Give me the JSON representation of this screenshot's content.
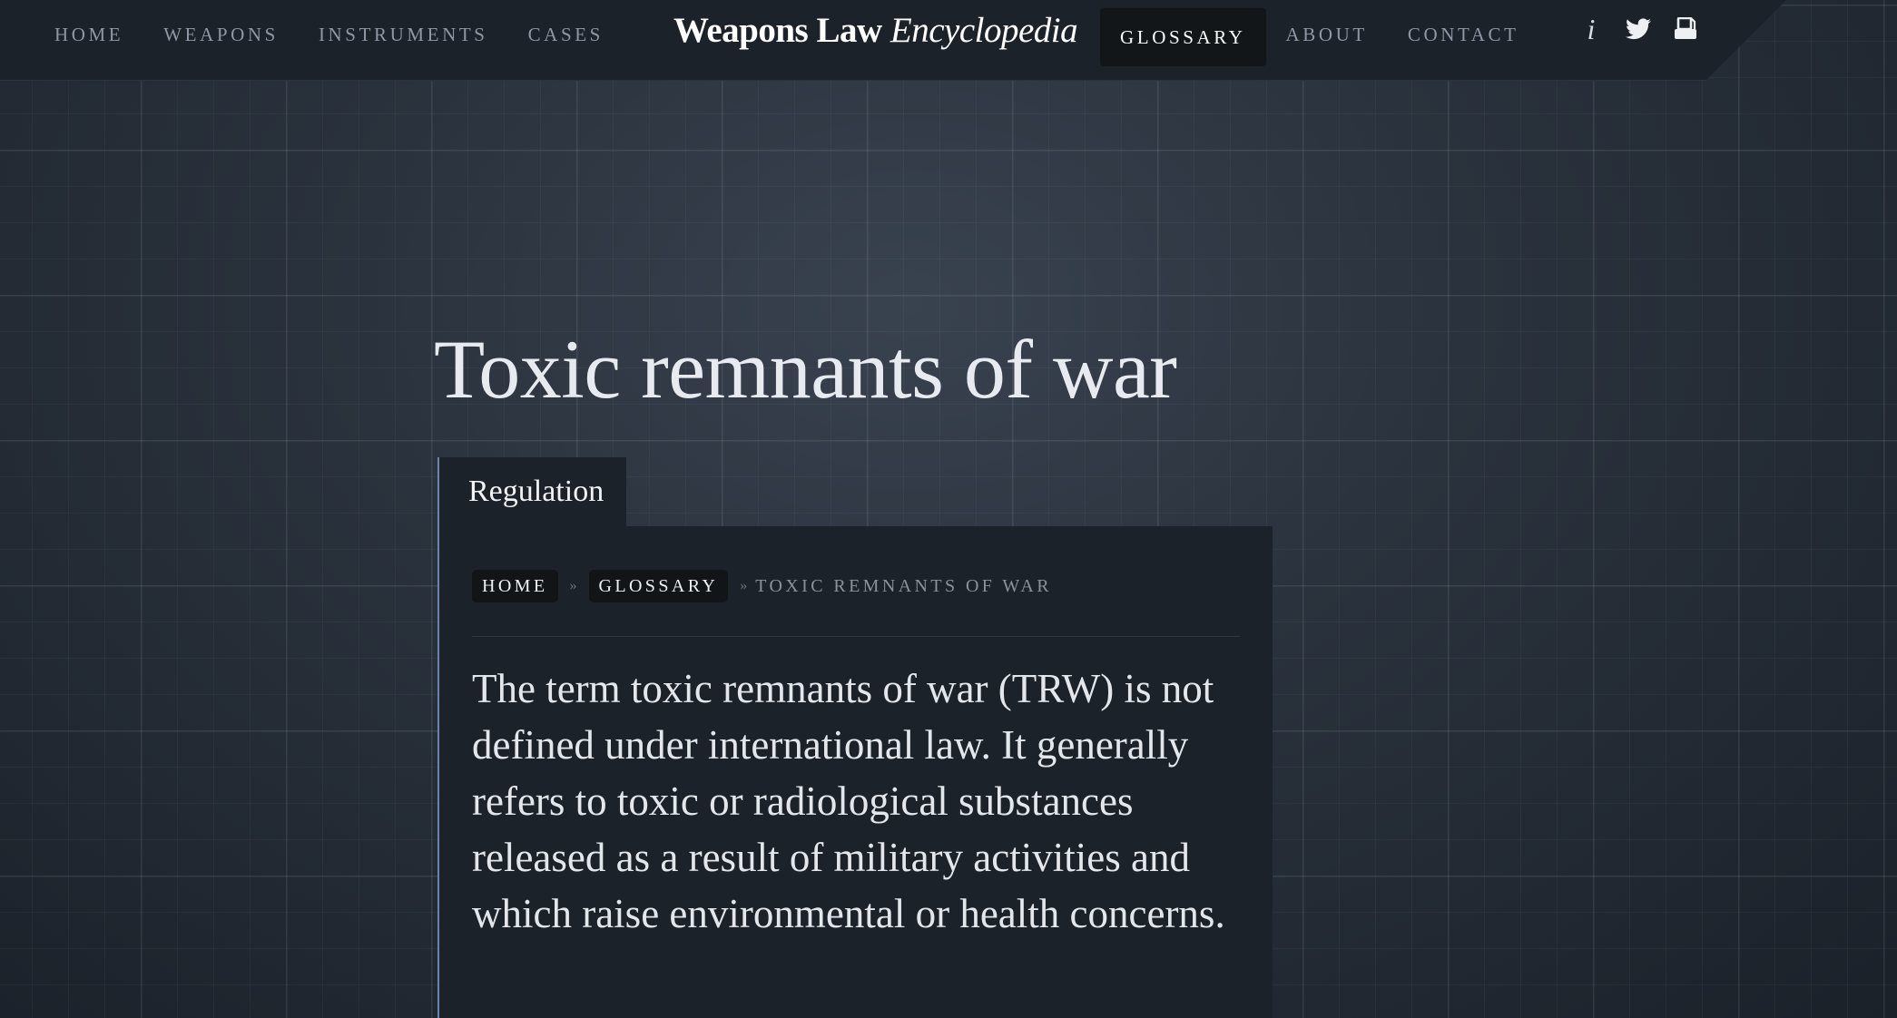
{
  "nav": {
    "left": [
      {
        "label": "HOME"
      },
      {
        "label": "WEAPONS"
      },
      {
        "label": "INSTRUMENTS"
      },
      {
        "label": "CASES"
      }
    ],
    "brand": {
      "part1": "Weapons Law",
      "part2": "Encyclopedia"
    },
    "right": [
      {
        "label": "GLOSSARY",
        "active": true
      },
      {
        "label": "ABOUT"
      },
      {
        "label": "CONTACT"
      }
    ],
    "icons": {
      "info": "i",
      "names": [
        "info-icon",
        "twitter-icon",
        "print-icon"
      ]
    }
  },
  "page": {
    "title": "Toxic remnants of war",
    "tab": "Regulation",
    "breadcrumb": {
      "home": "HOME",
      "glossary": "GLOSSARY",
      "separator": "»",
      "current": "TOXIC REMNANTS OF WAR"
    },
    "lead": "The term toxic remnants of war (TRW) is not defined under international law. It generally refers to toxic or radiological substances released as a result of military activities and which raise environmental or health concerns."
  },
  "colors": {
    "background": "#2a323d",
    "panel": "#1c2229",
    "accent_border": "#6b85a8",
    "nav_text": "#8e98a4",
    "active_nav_bg": "#121619"
  }
}
